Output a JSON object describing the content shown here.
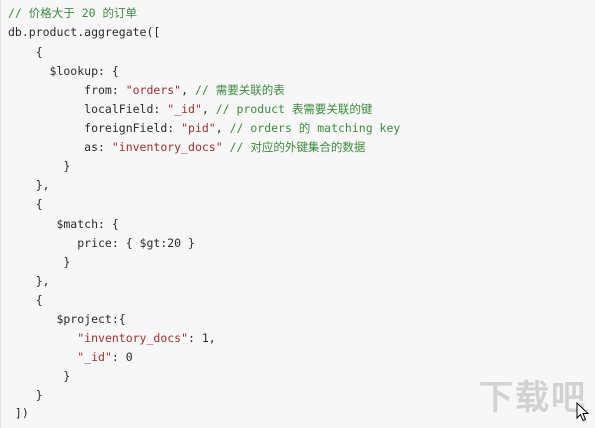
{
  "code": {
    "lines": [
      {
        "parts": [
          {
            "t": "// 价格大于 20 的订单",
            "c": "cm"
          }
        ]
      },
      {
        "parts": [
          {
            "t": "db.product.aggregate([",
            "c": "kw"
          }
        ]
      },
      {
        "parts": [
          {
            "t": "    {",
            "c": "kw"
          }
        ]
      },
      {
        "parts": [
          {
            "t": "      $lookup: {",
            "c": "kw"
          }
        ]
      },
      {
        "parts": [
          {
            "t": "           from: ",
            "c": "kw"
          },
          {
            "t": "\"orders\"",
            "c": "st"
          },
          {
            "t": ", ",
            "c": "kw"
          },
          {
            "t": "// 需要关联的表",
            "c": "cm"
          }
        ]
      },
      {
        "parts": [
          {
            "t": "           localField: ",
            "c": "kw"
          },
          {
            "t": "\"_id\"",
            "c": "st"
          },
          {
            "t": ", ",
            "c": "kw"
          },
          {
            "t": "// product 表需要关联的键",
            "c": "cm"
          }
        ]
      },
      {
        "parts": [
          {
            "t": "           foreignField: ",
            "c": "kw"
          },
          {
            "t": "\"pid\"",
            "c": "st"
          },
          {
            "t": ", ",
            "c": "kw"
          },
          {
            "t": "// orders 的 matching key",
            "c": "cm"
          }
        ]
      },
      {
        "parts": [
          {
            "t": "           as: ",
            "c": "kw"
          },
          {
            "t": "\"inventory_docs\"",
            "c": "st"
          },
          {
            "t": " ",
            "c": "kw"
          },
          {
            "t": "// 对应的外键集合的数据",
            "c": "cm"
          }
        ]
      },
      {
        "parts": [
          {
            "t": "        }",
            "c": "kw"
          }
        ]
      },
      {
        "parts": [
          {
            "t": "    },",
            "c": "kw"
          }
        ]
      },
      {
        "parts": [
          {
            "t": "    {",
            "c": "kw"
          }
        ]
      },
      {
        "parts": [
          {
            "t": "       $match: {",
            "c": "kw"
          }
        ]
      },
      {
        "parts": [
          {
            "t": "          price: { $gt:20 }",
            "c": "kw"
          }
        ]
      },
      {
        "parts": [
          {
            "t": "        }",
            "c": "kw"
          }
        ]
      },
      {
        "parts": [
          {
            "t": "    },",
            "c": "kw"
          }
        ]
      },
      {
        "parts": [
          {
            "t": "    {",
            "c": "kw"
          }
        ]
      },
      {
        "parts": [
          {
            "t": "       $project:{",
            "c": "kw"
          }
        ]
      },
      {
        "parts": [
          {
            "t": "          ",
            "c": "kw"
          },
          {
            "t": "\"inventory_docs\"",
            "c": "st"
          },
          {
            "t": ": 1,",
            "c": "kw"
          }
        ]
      },
      {
        "parts": [
          {
            "t": "          ",
            "c": "kw"
          },
          {
            "t": "\"_id\"",
            "c": "st"
          },
          {
            "t": ": 0",
            "c": "kw"
          }
        ]
      },
      {
        "parts": [
          {
            "t": "        }",
            "c": "kw"
          }
        ]
      },
      {
        "parts": [
          {
            "t": "    }",
            "c": "kw"
          }
        ]
      },
      {
        "parts": [
          {
            "t": " ])",
            "c": "kw"
          }
        ]
      }
    ]
  },
  "watermark": {
    "text": "下载吧"
  },
  "colors": {
    "comment": "#3d8b3d",
    "string": "#a03030",
    "text": "#2b2b2b",
    "background": "#f7f7f7"
  }
}
